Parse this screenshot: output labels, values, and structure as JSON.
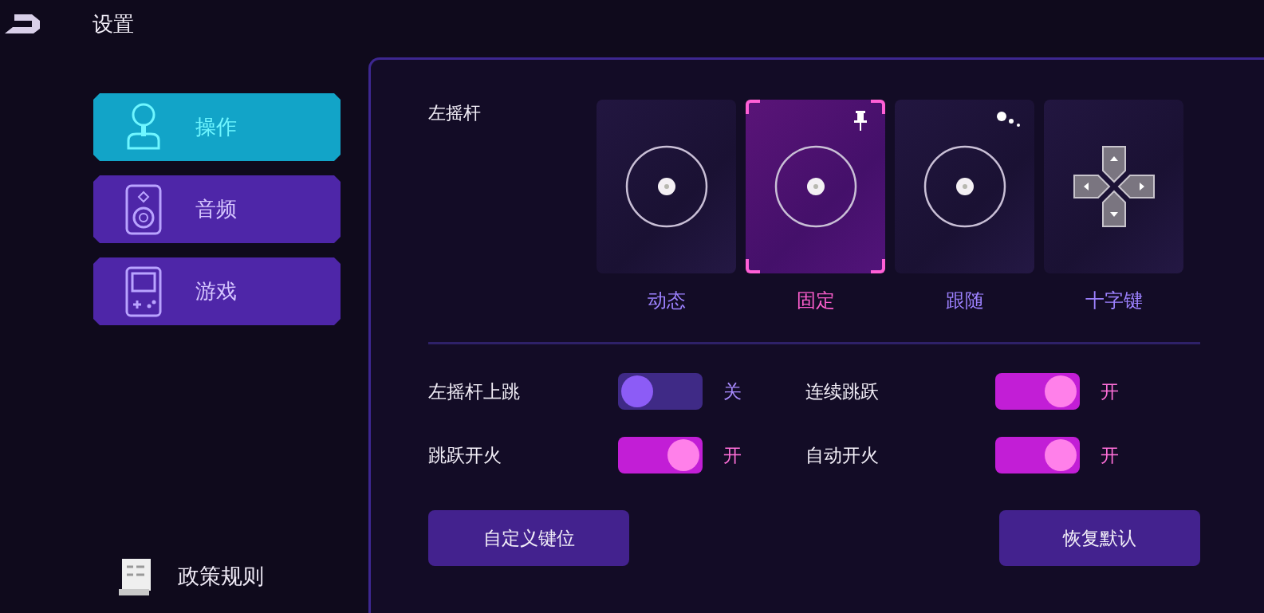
{
  "header": {
    "title": "设置"
  },
  "nav": [
    {
      "label": "操作",
      "selected": true
    },
    {
      "label": "音频",
      "selected": false
    },
    {
      "label": "游戏",
      "selected": false
    }
  ],
  "policy": {
    "label": "政策规则"
  },
  "left_stick": {
    "label": "左摇杆",
    "options": [
      {
        "label": "动态",
        "kind": "stick",
        "selected": false
      },
      {
        "label": "固定",
        "kind": "stick",
        "selected": true
      },
      {
        "label": "跟随",
        "kind": "stick",
        "selected": false
      },
      {
        "label": "十字键",
        "kind": "dpad",
        "selected": false
      }
    ]
  },
  "toggles": [
    {
      "label": "左摇杆上跳",
      "on": false,
      "value": "关"
    },
    {
      "label": "连续跳跃",
      "on": true,
      "value": "开"
    },
    {
      "label": "跳跃开火",
      "on": true,
      "value": "开"
    },
    {
      "label": "自动开火",
      "on": true,
      "value": "开"
    }
  ],
  "buttons": [
    "自定义键位",
    "恢复默认"
  ]
}
